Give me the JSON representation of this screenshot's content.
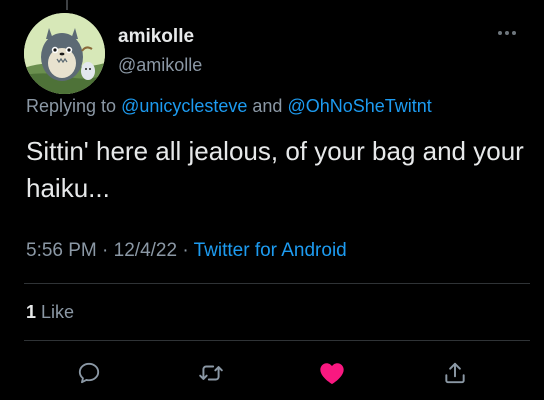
{
  "user": {
    "display_name": "amikolle",
    "handle": "@amikolle"
  },
  "reply": {
    "prefix": "Replying to ",
    "mention_1": "@unicyclesteve",
    "joiner": " and ",
    "mention_2": "@OhNoSheTwitnt"
  },
  "tweet": {
    "text": "Sittin' here all jealous, of your bag and your haiku..."
  },
  "meta": {
    "time": "5:56 PM",
    "sep_1": " · ",
    "date": "12/4/22",
    "sep_2": " · ",
    "source": "Twitter for Android"
  },
  "engagement": {
    "like_count": "1",
    "like_label": " Like"
  },
  "actions": {
    "reply_icon": "reply-bubble-icon",
    "retweet_icon": "retweet-arrows-icon",
    "like_icon": "heart-filled-icon",
    "share_icon": "share-upload-icon"
  },
  "colors": {
    "background": "#000000",
    "text": "#e7e9ea",
    "muted": "#8b98a5",
    "accent": "#1d9bf0",
    "like": "#f91880",
    "divider": "#2f3336"
  }
}
